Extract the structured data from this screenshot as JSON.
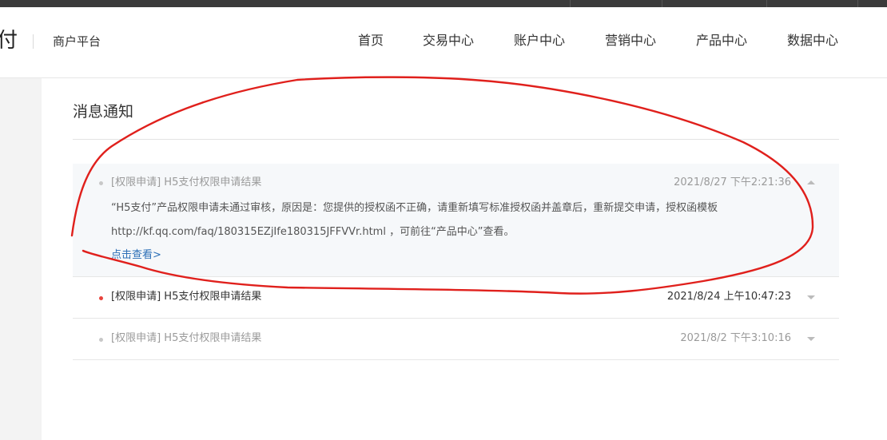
{
  "header": {
    "logo_fragment": "付",
    "platform_label": "商户平台",
    "nav": [
      "首页",
      "交易中心",
      "账户中心",
      "营销中心",
      "产品中心",
      "数据中心"
    ]
  },
  "main": {
    "title": "消息通知",
    "messages": [
      {
        "tag": "[权限申请]",
        "subject": "H5支付权限申请结果",
        "time": "2021/8/27 下午2:21:36",
        "expanded": true,
        "read": true,
        "body_line1": "“H5支付”产品权限申请未通过审核，原因是：您提供的授权函不正确，请重新填写标准授权函并盖章后，重新提交申请，授权函模板",
        "body_line2": "http://kf.qq.com/faq/180315EZjIfe180315JFFVVr.html ，可前往“产品中心”查看。",
        "link": "点击查看>"
      },
      {
        "tag": "[权限申请]",
        "subject": "H5支付权限申请结果",
        "time": "2021/8/24 上午10:47:23",
        "expanded": false,
        "read": false
      },
      {
        "tag": "[权限申请]",
        "subject": "H5支付权限申请结果",
        "time": "2021/8/2 下午3:10:16",
        "expanded": false,
        "read": true
      }
    ]
  },
  "colors": {
    "unread_dot": "#e8433c",
    "read_dot": "#c8c8c8",
    "link": "#2c6fb7",
    "annotation_ink": "#e0201c"
  },
  "icons": {
    "expand_up": "caret-up-icon",
    "expand_down": "caret-down-icon"
  }
}
